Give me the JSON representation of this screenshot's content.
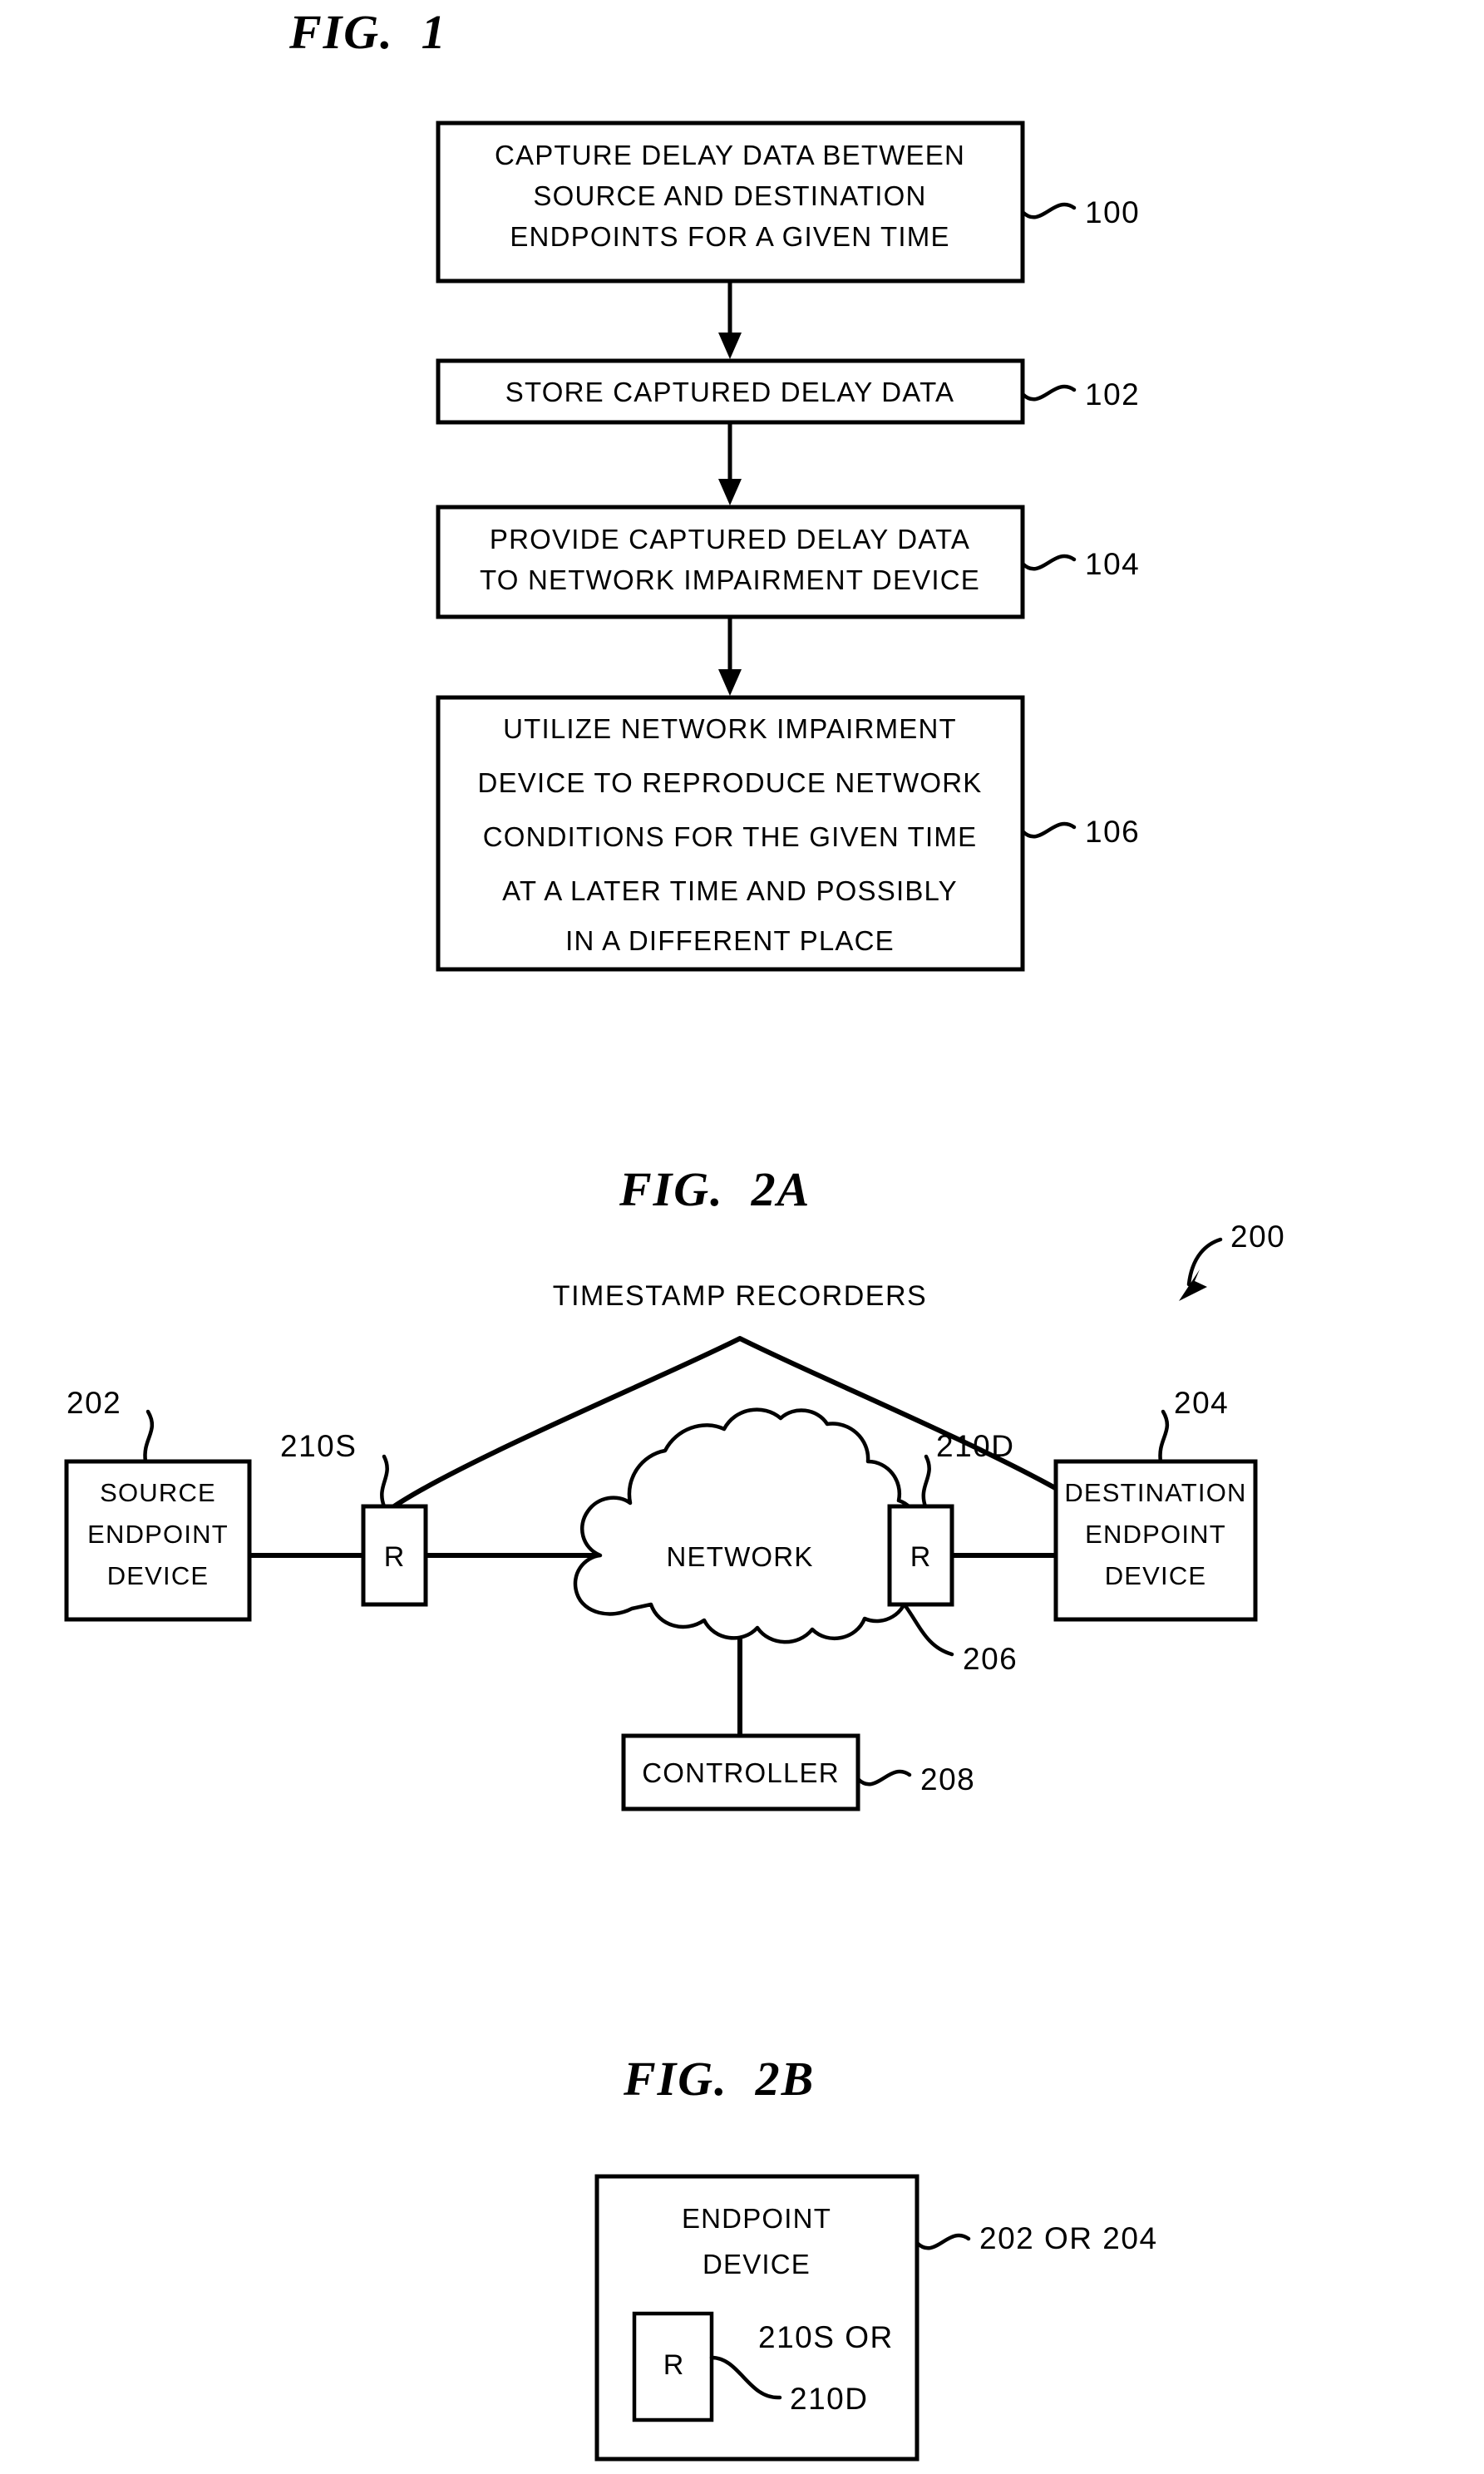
{
  "sheet": {
    "background_color": "#ffffff",
    "ink_color": "#000000"
  },
  "figures": [
    {
      "id": "fig1",
      "title": "FIG.  1",
      "type": "flowchart",
      "steps": [
        {
          "ref": "100",
          "lines": [
            "CAPTURE DELAY DATA BETWEEN",
            "SOURCE AND DESTINATION",
            "ENDPOINTS FOR A GIVEN TIME"
          ]
        },
        {
          "ref": "102",
          "lines": [
            "STORE CAPTURED DELAY DATA"
          ]
        },
        {
          "ref": "104",
          "lines": [
            "PROVIDE CAPTURED DELAY DATA",
            "TO NETWORK IMPAIRMENT DEVICE"
          ]
        },
        {
          "ref": "106",
          "lines": [
            "UTILIZE NETWORK IMPAIRMENT",
            "DEVICE TO REPRODUCE NETWORK",
            "CONDITIONS FOR THE GIVEN TIME",
            "AT A LATER TIME AND POSSIBLY",
            "IN A DIFFERENT PLACE"
          ]
        }
      ]
    },
    {
      "id": "fig2a",
      "title": "FIG.  2A",
      "type": "network-diagram",
      "system_ref": "200",
      "bracket_caption": "TIMESTAMP RECORDERS",
      "nodes": [
        {
          "name": "source-endpoint-device",
          "ref": "202",
          "lines": [
            "SOURCE",
            "ENDPOINT",
            "DEVICE"
          ]
        },
        {
          "name": "source-recorder",
          "ref": "210S",
          "lines": [
            "R"
          ]
        },
        {
          "name": "network-cloud",
          "ref": "206",
          "lines": [
            "NETWORK"
          ]
        },
        {
          "name": "destination-recorder",
          "ref": "210D",
          "lines": [
            "R"
          ]
        },
        {
          "name": "destination-endpoint-device",
          "ref": "204",
          "lines": [
            "DESTINATION",
            "ENDPOINT",
            "DEVICE"
          ]
        },
        {
          "name": "controller",
          "ref": "208",
          "lines": [
            "CONTROLLER"
          ]
        }
      ]
    },
    {
      "id": "fig2b",
      "title": "FIG.  2B",
      "type": "block-diagram",
      "outer": {
        "ref": "202 OR 204",
        "lines": [
          "ENDPOINT",
          "DEVICE"
        ]
      },
      "inner": {
        "ref_line1": "210S OR",
        "ref_line2": "210D",
        "lines": [
          "R"
        ]
      }
    }
  ]
}
